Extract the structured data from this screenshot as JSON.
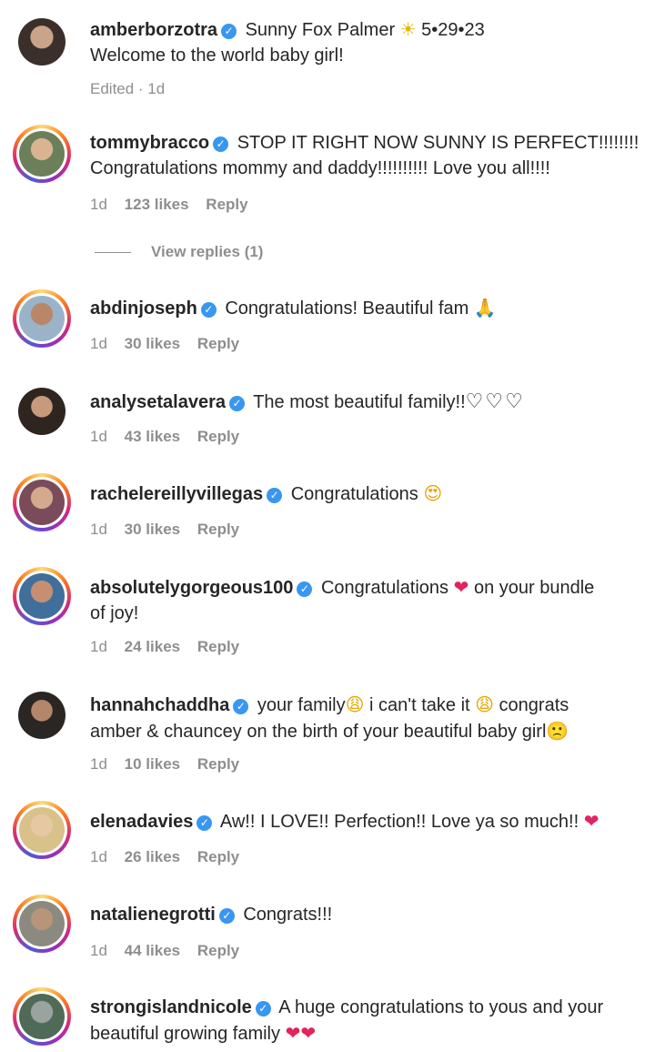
{
  "comments": [
    {
      "user": "amberborzotra",
      "text": "Sunny Fox Palmer",
      "emoji": "☀",
      "text2": " 5•29•23",
      "line2": "Welcome to the world baby girl!",
      "meta": {
        "edited": "Edited · 1d"
      }
    },
    {
      "user": "tommybracco",
      "text": "STOP IT RIGHT NOW SUNNY IS PERFECT!!!!!!!!",
      "line2": "Congratulations mommy and daddy!!!!!!!!!! Love you all!!!!",
      "meta": {
        "time": "1d",
        "likes": "123 likes",
        "reply": "Reply"
      },
      "view_replies": "View replies (1)"
    },
    {
      "user": "abdinjoseph",
      "text": "Congratulations! Beautiful fam",
      "emoji": "🙏",
      "meta": {
        "time": "1d",
        "likes": "30 likes",
        "reply": "Reply"
      }
    },
    {
      "user": "analysetalavera",
      "text": "The most beautiful family!!",
      "emoji": "♡♡♡",
      "meta": {
        "time": "1d",
        "likes": "43 likes",
        "reply": "Reply"
      }
    },
    {
      "user": "rachelereillyvillegas",
      "text": "Congratulations",
      "emoji": "😍",
      "meta": {
        "time": "1d",
        "likes": "30 likes",
        "reply": "Reply"
      }
    },
    {
      "user": "absolutelygorgeous100",
      "text": "Congratulations",
      "emoji": "❤",
      "text2": " on your bundle",
      "line2": "of joy!",
      "meta": {
        "time": "1d",
        "likes": "24 likes",
        "reply": "Reply"
      }
    },
    {
      "user": "hannahchaddha",
      "text": "your family",
      "emoji": "😩",
      "text2": " i can't take it",
      "emoji2": "😩",
      "text3": " congrats",
      "line2": "amber & chauncey on the birth of your beautiful baby girl",
      "emoji3": "🙁",
      "meta": {
        "time": "1d",
        "likes": "10 likes",
        "reply": "Reply"
      }
    },
    {
      "user": "elenadavies",
      "text": "Aw!! I LOVE!! Perfection!! Love ya so much!!",
      "emoji": "❤",
      "meta": {
        "time": "1d",
        "likes": "26 likes",
        "reply": "Reply"
      }
    },
    {
      "user": "natalienegrotti",
      "text": "Congrats!!!",
      "meta": {
        "time": "1d",
        "likes": "44 likes",
        "reply": "Reply"
      }
    },
    {
      "user": "strongislandnicole",
      "text": "A huge congratulations to yous and your",
      "line2": "beautiful growing family",
      "emoji": "❤❤"
    }
  ],
  "verified_mark": "✓",
  "colors": {
    "verified": "#3897f0",
    "heart": "#e0245e",
    "muted": "#8e8e8e"
  }
}
